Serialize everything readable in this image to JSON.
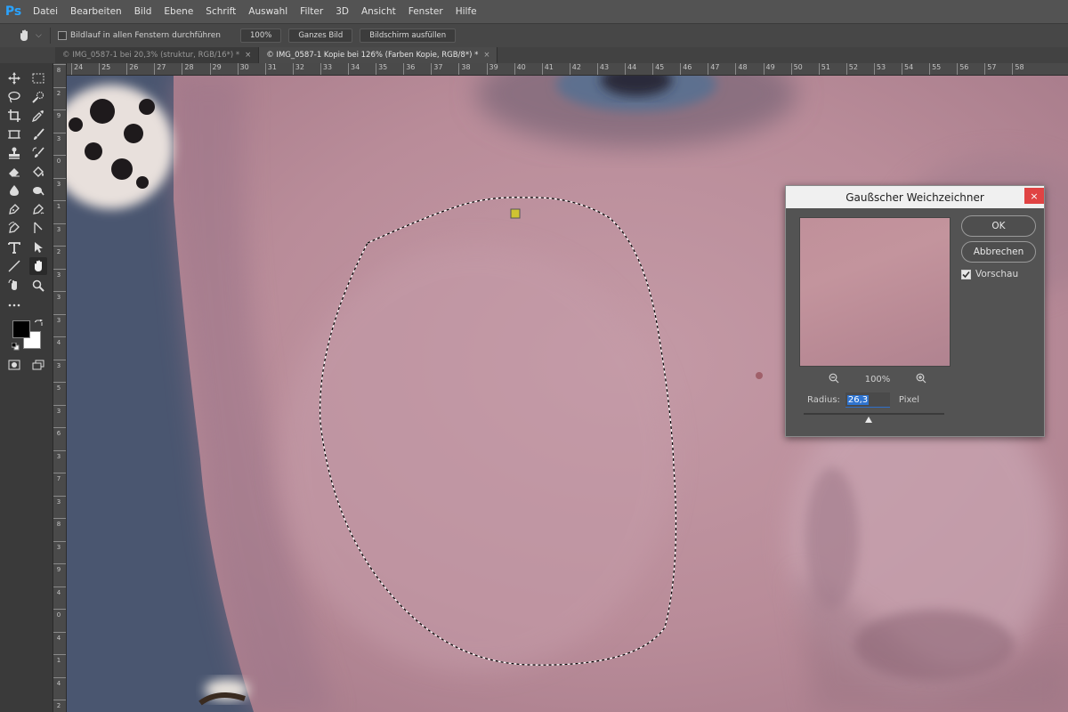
{
  "app": {
    "logo": "Ps",
    "accent": "#2aa3ff"
  },
  "menu": [
    "Datei",
    "Bearbeiten",
    "Bild",
    "Ebene",
    "Schrift",
    "Auswahl",
    "Filter",
    "3D",
    "Ansicht",
    "Fenster",
    "Hilfe"
  ],
  "options_bar": {
    "tool_icon": "hand-icon",
    "scroll_all_label": "Bildlauf in allen Fenstern durchführen",
    "scroll_all_checked": false,
    "zoom_button": "100%",
    "fit_button": "Ganzes Bild",
    "fill_button": "Bildschirm ausfüllen"
  },
  "panel_collapse": "«",
  "tabs": [
    {
      "label": "© IMG_0587-1 bei 20,3% (struktur, RGB/16*) *",
      "close": "×",
      "active": false
    },
    {
      "label": "© IMG_0587-1 Kopie bei 126% (Farben Kopie, RGB/8*) *",
      "close": "×",
      "active": true
    }
  ],
  "ruler_h": [
    "24",
    "25",
    "26",
    "27",
    "28",
    "29",
    "30",
    "31",
    "32",
    "33",
    "34",
    "35",
    "36",
    "37",
    "38",
    "39",
    "40",
    "41",
    "42",
    "43",
    "44",
    "45",
    "46",
    "47",
    "48",
    "49",
    "50",
    "51",
    "52",
    "53",
    "54",
    "55",
    "56",
    "57",
    "58"
  ],
  "ruler_v": [
    "8",
    "2",
    "9",
    "3",
    "0",
    "3",
    "1",
    "3",
    "2",
    "3",
    "3",
    "3",
    "4",
    "3",
    "5",
    "3",
    "6",
    "3",
    "7",
    "3",
    "8",
    "3",
    "9",
    "4",
    "0",
    "4",
    "1",
    "4",
    "2"
  ],
  "tools": [
    "move-icon",
    "marquee-icon",
    "lasso-icon",
    "quick-select-icon",
    "crop-icon",
    "eyedropper-icon",
    "frame-icon",
    "brush-icon",
    "stamp-icon",
    "history-brush-icon",
    "eraser-icon",
    "paint-bucket-icon",
    "blur-icon",
    "dodge-icon",
    "pen-icon",
    "freeform-pen-icon",
    "curvature-pen-icon",
    "direct-select-icon",
    "type-icon",
    "path-select-icon",
    "line-icon",
    "hand-icon",
    "rotate-view-icon",
    "zoom-icon",
    "more-tools-icon",
    "swap-colors-icon",
    "default-colors-icon",
    "quick-mask-icon",
    "screen-mode-icon"
  ],
  "colors": {
    "foreground": "#000000",
    "background": "#ffffff"
  },
  "dialog": {
    "title": "Gaußscher Weichzeichner",
    "close": "×",
    "ok_label": "OK",
    "cancel_label": "Abbrechen",
    "preview_label": "Vorschau",
    "preview_checked": true,
    "zoom_level": "100%",
    "radius_label": "Radius:",
    "radius_value": "26,3",
    "radius_unit": "Pixel",
    "radius_slider_fraction": 0.46
  }
}
